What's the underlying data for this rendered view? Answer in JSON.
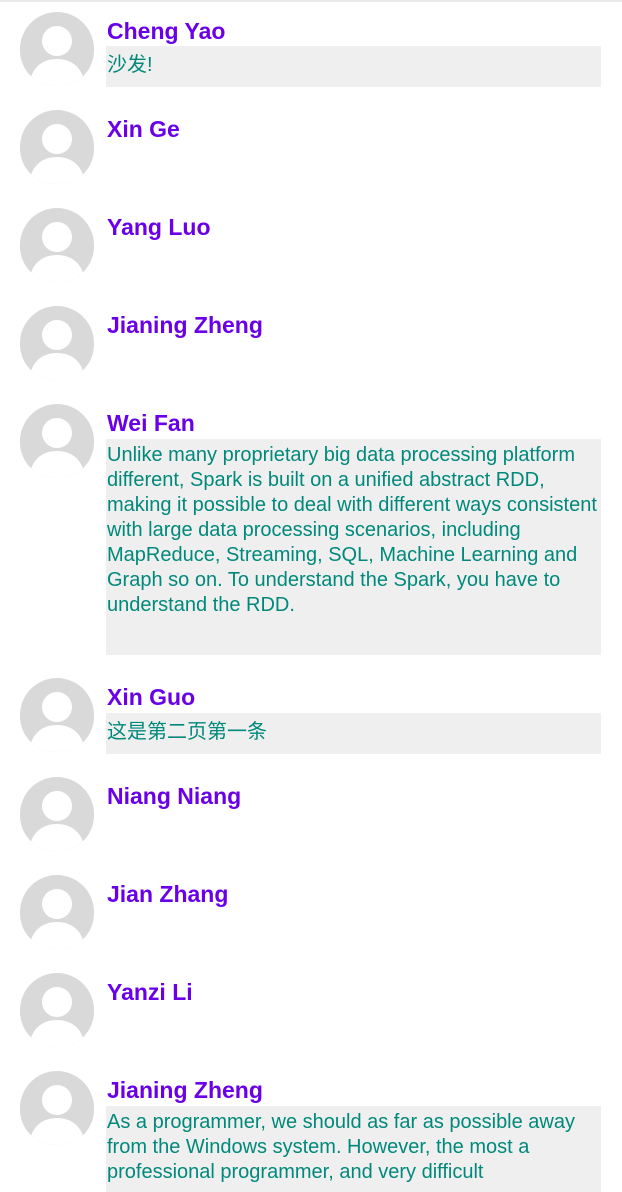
{
  "comments": [
    {
      "author": "Cheng Yao",
      "text": "沙发!"
    },
    {
      "author": "Xin Ge",
      "text": ""
    },
    {
      "author": "Yang Luo",
      "text": ""
    },
    {
      "author": "Jianing Zheng",
      "text": ""
    },
    {
      "author": "Wei Fan",
      "text": "Unlike many proprietary big data processing platform different, Spark is built on a unified abstract RDD, making it possible to deal with different ways consistent with large data processing scenarios, including MapReduce, Streaming, SQL, Machine Learning and Graph so on. To understand the Spark, you have to understand the RDD."
    },
    {
      "author": "Xin Guo",
      "text": "这是第二页第一条"
    },
    {
      "author": "Niang Niang",
      "text": ""
    },
    {
      "author": "Jian Zhang",
      "text": ""
    },
    {
      "author": "Yanzi Li",
      "text": ""
    },
    {
      "author": "Jianing Zheng",
      "text": "As a programmer, we should as far as possible away from the Windows system. However, the most a professional programmer, and very difficult"
    }
  ],
  "icons": {
    "avatar": "default-user-avatar-icon"
  },
  "colors": {
    "author": "#6a00e8",
    "comment_text": "#00897b",
    "comment_bg": "#efefef"
  }
}
